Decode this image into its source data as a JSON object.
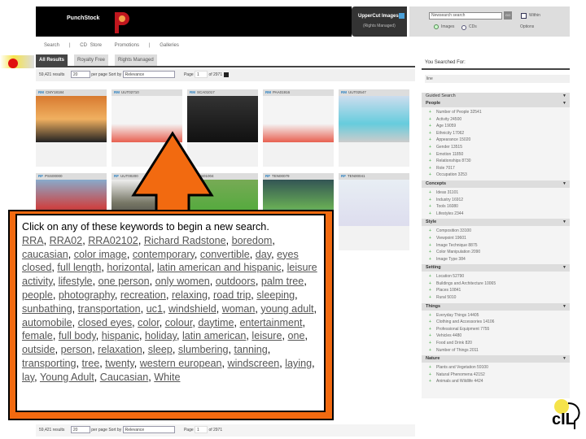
{
  "header": {
    "brand": "PunchStock",
    "partner_title": "UpperCut Images",
    "partner_sub": "(Rights Managed)",
    "search_value": "Newsearch search",
    "go": "GO",
    "within": "Within",
    "radio_images": "Images",
    "radio_cds": "CDs",
    "options": "Options"
  },
  "nav": [
    "Search",
    "CD Store",
    "Promotions",
    "Galleries"
  ],
  "tabs": [
    "All Results",
    "Royalty Free",
    "Rights Managed"
  ],
  "toolbar": {
    "results": "59,421 results",
    "per_page_value": "20",
    "per_page": "per page",
    "sort_by": "Sort by",
    "sort_value": "Relevance",
    "page_label": "Page",
    "page_value": "1",
    "of_pages": "of 2971"
  },
  "thumbs": [
    {
      "id": "CMY18184",
      "tag": "RM"
    },
    {
      "id": "UUT02710",
      "tag": "RM"
    },
    {
      "id": "SCA01017",
      "tag": "RM"
    },
    {
      "id": "PAA01916",
      "tag": "RM"
    },
    {
      "id": "UUT02547",
      "tag": "RM"
    },
    {
      "id": "PSS00000",
      "tag": "RF"
    },
    {
      "id": "UUT00200",
      "tag": "RF"
    },
    {
      "id": "PSS01004",
      "tag": "RF"
    },
    {
      "id": "TEN00079",
      "tag": "RF"
    },
    {
      "id": "TEN00041",
      "tag": "RF"
    }
  ],
  "sidebar": {
    "you_searched": "You Searched For:",
    "query": "line",
    "guided": "Guided Search",
    "groups": [
      {
        "title": "People",
        "items": [
          "Number of People  32541",
          "Activity  24500",
          "Age  19059",
          "Ethnicity  17062",
          "Appearance  15020",
          "Gender  13515",
          "Emotion  11850",
          "Relationships  8730",
          "Role  7017",
          "Occupation  3253"
        ]
      },
      {
        "title": "Concepts",
        "items": [
          "Ideas  31101",
          "Industry  16912",
          "Tools  16080",
          "Lifestyles  2344"
        ]
      },
      {
        "title": "Style",
        "items": [
          "Composition  33100",
          "Viewpoint  19601",
          "Image Technique  8875",
          "Color Manipulation  2090",
          "Image Type  384"
        ]
      },
      {
        "title": "Setting",
        "items": [
          "Location  52790",
          "Buildings and Architecture  10065",
          "Places  10841",
          "Rural  5010"
        ]
      },
      {
        "title": "Things",
        "items": [
          "Everyday Things  14405",
          "Clothing and Accessories  14106",
          "Professional Equipment  7755",
          "Vehicles  4480",
          "Food and Drink  820",
          "Number of Things  2011"
        ]
      },
      {
        "title": "Nature",
        "items": [
          "Plants and Vegetation  59100",
          "Natural Phenomena  42152",
          "Animals and Wildlife  4424"
        ]
      }
    ]
  },
  "callout": {
    "intro": "Click on any of these keywords to begin a new search.",
    "keywords": [
      "RRA",
      "RRA02",
      "RRA02102",
      "Richard Radstone",
      "boredom",
      "caucasian",
      "color image",
      "contemporary",
      "convertible",
      "day",
      "eyes closed",
      "full length",
      "horizontal",
      "latin american and hispanic",
      "leisure activity",
      "lifestyle",
      "one person",
      "only women",
      "outdoors",
      "palm tree",
      "people",
      "photography",
      "recreation",
      "relaxing",
      "road trip",
      "sleeping",
      "sunbathing",
      "transportation",
      "uc1",
      "windshield",
      "woman",
      "young adult",
      "automobile",
      "closed eyes",
      "color",
      "colour",
      "daytime",
      "entertainment",
      "female",
      "full body",
      "hispanic",
      "holiday",
      "latin american",
      "leisure",
      "one",
      "outside",
      "person",
      "relaxation",
      "sleep",
      "slumbering",
      "tanning",
      "transporting",
      "tree",
      "twenty",
      "western european",
      "windscreen",
      "laying",
      "lay",
      "Young Adult",
      "Caucasian",
      "White"
    ]
  },
  "colors": {
    "accent": "#f26a10"
  }
}
